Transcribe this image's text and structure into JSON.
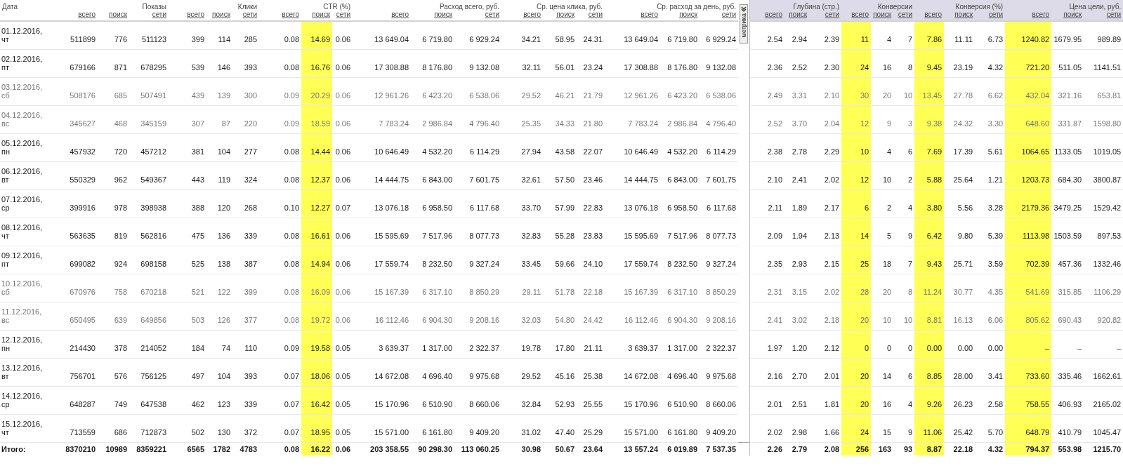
{
  "table": {
    "date_header": "Дата",
    "direct_groups": [
      {
        "title": "Показы",
        "columns": [
          {
            "label": "всего",
            "highlighted": false
          },
          {
            "label": "поиск",
            "highlighted": false
          },
          {
            "label": "сети",
            "highlighted": false
          }
        ]
      },
      {
        "title": "Клики",
        "columns": [
          {
            "label": "всего",
            "highlighted": false
          },
          {
            "label": "поиск",
            "highlighted": false
          },
          {
            "label": "сети",
            "highlighted": false
          }
        ]
      },
      {
        "title": "CTR (%)",
        "columns": [
          {
            "label": "всего",
            "highlighted": false
          },
          {
            "label": "поиск",
            "highlighted": true
          },
          {
            "label": "сети",
            "highlighted": false
          }
        ]
      },
      {
        "title": "Расход всего, руб.",
        "columns": [
          {
            "label": "всего",
            "highlighted": false
          },
          {
            "label": "поиск",
            "highlighted": false
          },
          {
            "label": "сети",
            "highlighted": false
          }
        ]
      },
      {
        "title": "Ср. цена клика, руб.",
        "columns": [
          {
            "label": "всего",
            "highlighted": false
          },
          {
            "label": "поиск",
            "highlighted": false
          },
          {
            "label": "сети",
            "highlighted": false
          }
        ]
      },
      {
        "title": "Ср. расход за день, руб.",
        "columns": [
          {
            "label": "всего",
            "highlighted": false
          },
          {
            "label": "поиск",
            "highlighted": false
          },
          {
            "label": "сети",
            "highlighted": false
          }
        ]
      }
    ],
    "metrika_tab": {
      "label": "метрика"
    },
    "metrika_groups": [
      {
        "title": "Глубина (стр.)",
        "columns": [
          {
            "label": "всего",
            "highlighted": false
          },
          {
            "label": "поиск",
            "highlighted": false
          },
          {
            "label": "сети",
            "highlighted": false
          }
        ]
      },
      {
        "title": "Конверсии",
        "columns": [
          {
            "label": "всего",
            "highlighted": true
          },
          {
            "label": "поиск",
            "highlighted": false
          },
          {
            "label": "сети",
            "highlighted": false
          }
        ]
      },
      {
        "title": "Конверсия (%)",
        "columns": [
          {
            "label": "всего",
            "highlighted": true
          },
          {
            "label": "поиск",
            "highlighted": false
          },
          {
            "label": "сети",
            "highlighted": false
          }
        ]
      },
      {
        "title": "Цена цели, руб.",
        "columns": [
          {
            "label": "всего",
            "highlighted": true
          },
          {
            "label": "поиск",
            "highlighted": false
          },
          {
            "label": "сети",
            "highlighted": false
          }
        ]
      }
    ],
    "rows": [
      {
        "date": "01.12.2016,",
        "weekday": "чт",
        "muted": false,
        "direct": [
          "511899",
          "776",
          "511123",
          "399",
          "114",
          "285",
          "0.08",
          "14.69",
          "0.06",
          "13 649.04",
          "6 719.80",
          "6 929.24",
          "34.21",
          "58.95",
          "24.31",
          "13 649.04",
          "6 719.80",
          "6 929.24"
        ],
        "metrika": [
          "2.54",
          "2.94",
          "2.39",
          "11",
          "4",
          "7",
          "7.86",
          "11.11",
          "6.73",
          "1240.82",
          "1679.95",
          "989.89"
        ]
      },
      {
        "date": "02.12.2016,",
        "weekday": "пт",
        "muted": false,
        "direct": [
          "679166",
          "871",
          "678295",
          "539",
          "146",
          "393",
          "0.08",
          "16.76",
          "0.06",
          "17 308.88",
          "8 176.80",
          "9 132.08",
          "32.11",
          "56.01",
          "23.24",
          "17 308.88",
          "8 176.80",
          "9 132.08"
        ],
        "metrika": [
          "2.36",
          "2.52",
          "2.30",
          "24",
          "16",
          "8",
          "9.45",
          "23.19",
          "4.32",
          "721.20",
          "511.05",
          "1141.51"
        ]
      },
      {
        "date": "03.12.2016,",
        "weekday": "сб",
        "muted": true,
        "direct": [
          "508176",
          "685",
          "507491",
          "439",
          "139",
          "300",
          "0.09",
          "20.29",
          "0.06",
          "12 961.26",
          "6 423.20",
          "6 538.06",
          "29.52",
          "46.21",
          "21.79",
          "12 961.26",
          "6 423.20",
          "6 538.06"
        ],
        "metrika": [
          "2.49",
          "3.31",
          "2.10",
          "30",
          "20",
          "10",
          "13.45",
          "27.78",
          "6.62",
          "432.04",
          "321.16",
          "653.81"
        ]
      },
      {
        "date": "04.12.2016,",
        "weekday": "вс",
        "muted": true,
        "direct": [
          "345627",
          "468",
          "345159",
          "307",
          "87",
          "220",
          "0.09",
          "18.59",
          "0.06",
          "7 783.24",
          "2 986.84",
          "4 796.40",
          "25.35",
          "34.33",
          "21.80",
          "7 783.24",
          "2 986.84",
          "4 796.40"
        ],
        "metrika": [
          "2.52",
          "3.70",
          "2.04",
          "12",
          "9",
          "3",
          "9.38",
          "24.32",
          "3.30",
          "648.60",
          "331.87",
          "1598.80"
        ]
      },
      {
        "date": "05.12.2016,",
        "weekday": "пн",
        "muted": false,
        "direct": [
          "457932",
          "720",
          "457212",
          "381",
          "104",
          "277",
          "0.08",
          "14.44",
          "0.06",
          "10 646.49",
          "4 532.20",
          "6 114.29",
          "27.94",
          "43.58",
          "22.07",
          "10 646.49",
          "4 532.20",
          "6 114.29"
        ],
        "metrika": [
          "2.38",
          "2.78",
          "2.29",
          "10",
          "4",
          "6",
          "7.69",
          "17.39",
          "5.61",
          "1064.65",
          "1133.05",
          "1019.05"
        ]
      },
      {
        "date": "06.12.2016,",
        "weekday": "вт",
        "muted": false,
        "direct": [
          "550329",
          "962",
          "549367",
          "443",
          "119",
          "324",
          "0.08",
          "12.37",
          "0.06",
          "14 444.75",
          "6 843.00",
          "7 601.75",
          "32.61",
          "57.50",
          "23.46",
          "14 444.75",
          "6 843.00",
          "7 601.75"
        ],
        "metrika": [
          "2.10",
          "2.41",
          "2.02",
          "12",
          "10",
          "2",
          "5.88",
          "25.64",
          "1.21",
          "1203.73",
          "684.30",
          "3800.87"
        ]
      },
      {
        "date": "07.12.2016,",
        "weekday": "ср",
        "muted": false,
        "direct": [
          "399916",
          "978",
          "398938",
          "388",
          "120",
          "268",
          "0.10",
          "12.27",
          "0.07",
          "13 076.18",
          "6 958.50",
          "6 117.68",
          "33.70",
          "57.99",
          "22.83",
          "13 076.18",
          "6 958.50",
          "6 117.68"
        ],
        "metrika": [
          "2.11",
          "1.89",
          "2.17",
          "6",
          "2",
          "4",
          "3.80",
          "5.56",
          "3.28",
          "2179.36",
          "3479.25",
          "1529.42"
        ]
      },
      {
        "date": "08.12.2016,",
        "weekday": "чт",
        "muted": false,
        "direct": [
          "563635",
          "819",
          "562816",
          "475",
          "136",
          "339",
          "0.08",
          "16.61",
          "0.06",
          "15 595.69",
          "7 517.96",
          "8 077.73",
          "32.83",
          "55.28",
          "23.83",
          "15 595.69",
          "7 517.96",
          "8 077.73"
        ],
        "metrika": [
          "2.09",
          "1.94",
          "2.13",
          "14",
          "5",
          "9",
          "6.42",
          "9.80",
          "5.39",
          "1113.98",
          "1503.59",
          "897.53"
        ]
      },
      {
        "date": "09.12.2016,",
        "weekday": "пт",
        "muted": false,
        "direct": [
          "699082",
          "924",
          "698158",
          "525",
          "138",
          "387",
          "0.08",
          "14.94",
          "0.06",
          "17 559.74",
          "8 232.50",
          "9 327.24",
          "33.45",
          "59.66",
          "24.10",
          "17 559.74",
          "8 232.50",
          "9 327.24"
        ],
        "metrika": [
          "2.35",
          "2.93",
          "2.15",
          "25",
          "18",
          "7",
          "9.43",
          "25.71",
          "3.59",
          "702.39",
          "457.36",
          "1332.46"
        ]
      },
      {
        "date": "10.12.2016,",
        "weekday": "сб",
        "muted": true,
        "direct": [
          "670976",
          "758",
          "670218",
          "521",
          "122",
          "399",
          "0.08",
          "16.09",
          "0.06",
          "15 167.39",
          "6 317.10",
          "8 850.29",
          "29.11",
          "51.78",
          "22.18",
          "15 167.39",
          "6 317.10",
          "8 850.29"
        ],
        "metrika": [
          "2.31",
          "3.15",
          "2.02",
          "28",
          "20",
          "8",
          "11.24",
          "30.77",
          "4.35",
          "541.69",
          "315.85",
          "1106.29"
        ]
      },
      {
        "date": "11.12.2016,",
        "weekday": "вс",
        "muted": true,
        "direct": [
          "650495",
          "639",
          "649856",
          "503",
          "126",
          "377",
          "0.08",
          "19.72",
          "0.06",
          "16 112.46",
          "6 904.30",
          "9 208.16",
          "32.03",
          "54.80",
          "24.42",
          "16 112.46",
          "6 904.30",
          "9 208.16"
        ],
        "metrika": [
          "2.41",
          "3.02",
          "2.18",
          "20",
          "10",
          "10",
          "8.81",
          "16.13",
          "6.06",
          "805.62",
          "690.43",
          "920.82"
        ]
      },
      {
        "date": "12.12.2016,",
        "weekday": "пн",
        "muted": false,
        "direct": [
          "214430",
          "378",
          "214052",
          "184",
          "74",
          "110",
          "0.09",
          "19.58",
          "0.05",
          "3 639.37",
          "1 317.00",
          "2 322.37",
          "19.78",
          "17.80",
          "21.11",
          "3 639.37",
          "1 317.00",
          "2 322.37"
        ],
        "metrika": [
          "1.97",
          "1.20",
          "2.12",
          "0",
          "0",
          "0",
          "0.00",
          "0.00",
          "0.00",
          "–",
          "–",
          "–"
        ]
      },
      {
        "date": "13.12.2016,",
        "weekday": "вт",
        "muted": false,
        "direct": [
          "756701",
          "576",
          "756125",
          "497",
          "104",
          "393",
          "0.07",
          "18.06",
          "0.05",
          "14 672.08",
          "4 696.40",
          "9 975.68",
          "29.52",
          "45.16",
          "25.38",
          "14 672.08",
          "4 696.40",
          "9 975.68"
        ],
        "metrika": [
          "2.16",
          "2.70",
          "2.01",
          "20",
          "14",
          "6",
          "8.85",
          "28.00",
          "3.41",
          "733.60",
          "335.46",
          "1662.61"
        ]
      },
      {
        "date": "14.12.2016,",
        "weekday": "ср",
        "muted": false,
        "direct": [
          "648287",
          "749",
          "647538",
          "462",
          "123",
          "339",
          "0.07",
          "16.42",
          "0.05",
          "15 170.96",
          "6 510.90",
          "8 660.06",
          "32.84",
          "52.93",
          "25.55",
          "15 170.96",
          "6 510.90",
          "8 660.06"
        ],
        "metrika": [
          "2.01",
          "2.51",
          "1.81",
          "20",
          "16",
          "4",
          "9.26",
          "26.23",
          "2.58",
          "758.55",
          "406.93",
          "2165.02"
        ]
      },
      {
        "date": "15.12.2016,",
        "weekday": "чт",
        "muted": false,
        "direct": [
          "713559",
          "686",
          "712873",
          "502",
          "130",
          "372",
          "0.07",
          "18.95",
          "0.05",
          "15 571.00",
          "6 161.80",
          "9 409.20",
          "31.02",
          "47.40",
          "25.29",
          "15 571.00",
          "6 161.80",
          "9 409.20"
        ],
        "metrika": [
          "2.02",
          "2.98",
          "1.66",
          "24",
          "15",
          "9",
          "11.06",
          "25.42",
          "5.70",
          "648.79",
          "410.79",
          "1045.47"
        ]
      }
    ],
    "total": {
      "label": "Итого:",
      "direct": [
        "8370210",
        "10989",
        "8359221",
        "6565",
        "1782",
        "4783",
        "0.08",
        "16.22",
        "0.06",
        "203 358.55",
        "90 298.30",
        "113 060.25",
        "30.98",
        "50.67",
        "23.64",
        "13 557.24",
        "6 019.89",
        "7 537.35"
      ],
      "metrika": [
        "2.26",
        "2.79",
        "2.08",
        "256",
        "163",
        "93",
        "8.87",
        "22.18",
        "4.32",
        "794.37",
        "553.98",
        "1215.70"
      ]
    }
  }
}
